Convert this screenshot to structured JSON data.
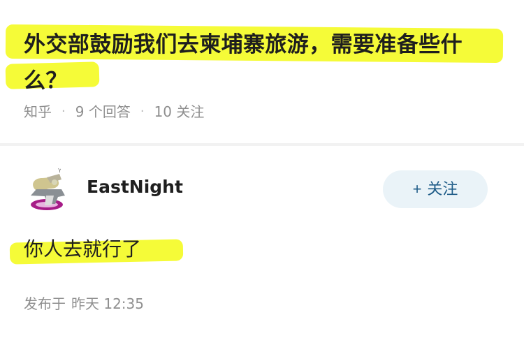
{
  "question": {
    "title": "外交部鼓励我们去柬埔寨旅游，需要准备些什么？"
  },
  "meta": {
    "source": "知乎",
    "answers": "9 个回答",
    "followers": "10 关注",
    "separator": "·"
  },
  "answer": {
    "author": "EastNight",
    "follow_label": "关注",
    "follow_icon": "+",
    "text": "你人去就行了",
    "posted_prefix": "发布于",
    "posted_time": "昨天 12:35"
  },
  "colors": {
    "highlight": "#f4fb2d",
    "follow_bg": "#eaf3f8",
    "follow_text": "#1f5c88",
    "meta_text": "#8f8f8f"
  }
}
